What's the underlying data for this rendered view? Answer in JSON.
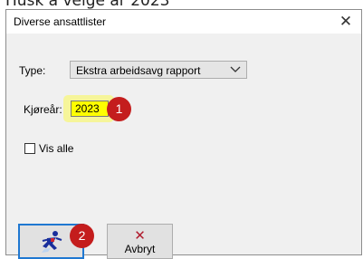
{
  "page_header_crop": "Husk å velge år 2023",
  "window": {
    "title": "Diverse ansattlister",
    "close_glyph": "✕"
  },
  "form": {
    "type_label": "Type:",
    "type_value": "Ekstra arbeidsavg rapport",
    "year_label": "Kjøreår:",
    "year_value": "2023",
    "show_all_label": "Vis alle",
    "show_all_checked": false
  },
  "buttons": {
    "run_icon": "running-figure-icon",
    "cancel_label": "Avbryt",
    "cancel_icon": "red-x-icon"
  },
  "annotations": {
    "marker_1": "1",
    "marker_2": "2",
    "highlight_color": "#ffff00",
    "marker_color": "#c41d1d"
  }
}
